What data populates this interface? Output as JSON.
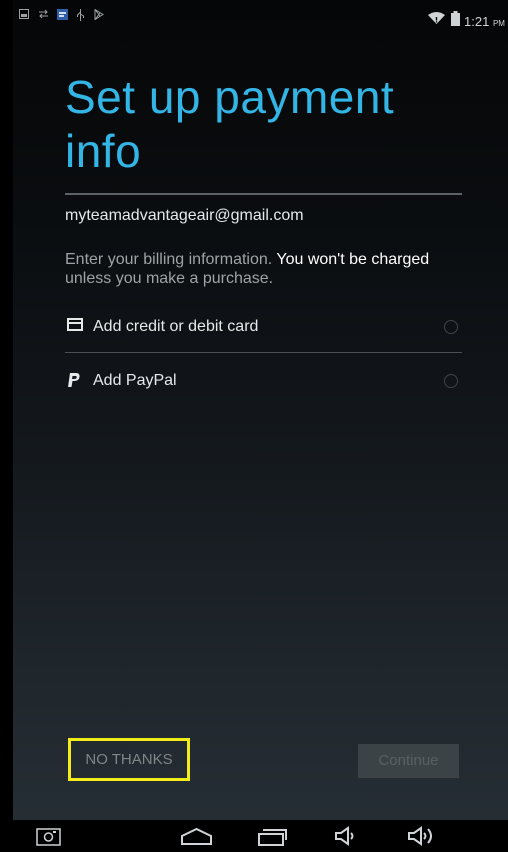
{
  "status_bar": {
    "time": "1:21",
    "ampm": "PM",
    "icons": [
      "gallery-icon",
      "sync-icon",
      "app-icon",
      "usb-icon",
      "play-store-icon",
      "wifi-icon",
      "battery-icon"
    ]
  },
  "page": {
    "title": "Set up payment info",
    "account_email": "myteamadvantageair@gmail.com",
    "billing_text_plain": "Enter your billing information.",
    "billing_text_emphasis": "You won't be charged",
    "billing_text_rest": "unless you make a purchase."
  },
  "options": [
    {
      "label": "Add credit or debit card",
      "icon": "credit-card-icon",
      "selected": false
    },
    {
      "label": "Add PayPal",
      "icon": "paypal-icon",
      "selected": false
    }
  ],
  "buttons": {
    "no_thanks": "NO THANKS",
    "continue": "Continue"
  },
  "nav_bar": {
    "icons": [
      "screenshot-icon",
      "home-icon",
      "recent-apps-icon",
      "volume-down-icon",
      "volume-up-icon"
    ]
  },
  "colors": {
    "title": "#33b5e5",
    "highlight": "#f1ec1a"
  }
}
